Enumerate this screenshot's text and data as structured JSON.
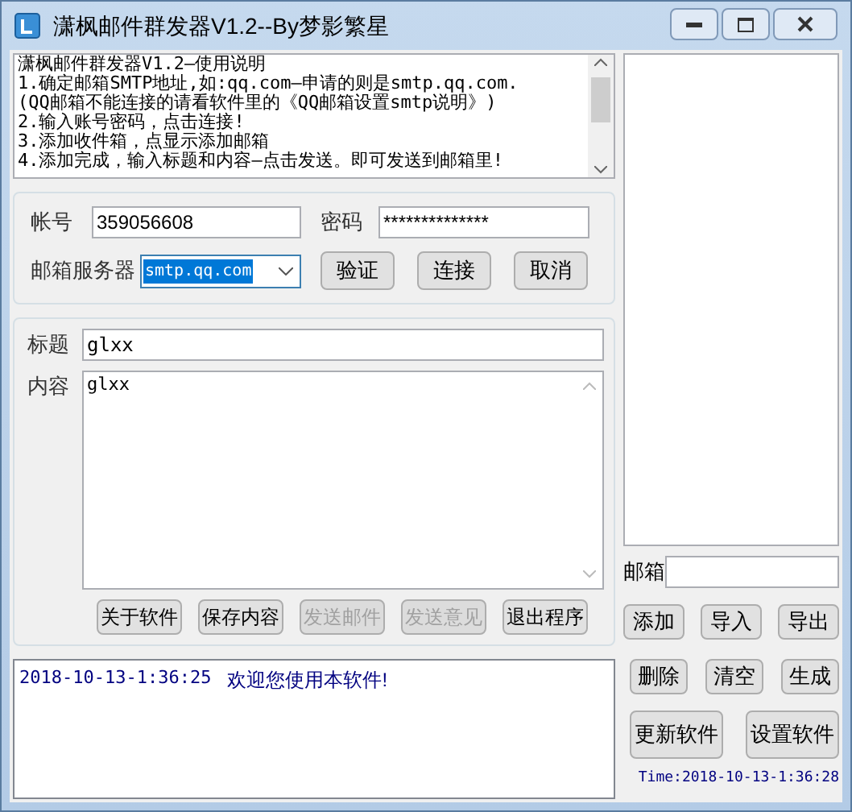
{
  "window": {
    "title": "潇枫邮件群发器V1.2--By梦影繁星"
  },
  "instructions": [
    "潇枫邮件群发器V1.2—使用说明",
    "1.确定邮箱SMTP地址,如:qq.com—申请的则是smtp.qq.com.",
    "(QQ邮箱不能连接的请看软件里的《QQ邮箱设置smtp说明》)",
    "2.输入账号密码，点击连接!",
    "3.添加收件箱，点显示添加邮箱",
    "4.添加完成，输入标题和内容—点击发送。即可发送到邮箱里!"
  ],
  "account": {
    "label": "帐号",
    "value": "359056608"
  },
  "password": {
    "label": "密码",
    "value": "**************"
  },
  "server": {
    "label": "邮箱服务器",
    "value": "smtp.qq.com"
  },
  "login_buttons": [
    {
      "label": "验证",
      "disabled": false
    },
    {
      "label": "连接",
      "disabled": false
    },
    {
      "label": "取消",
      "disabled": false
    }
  ],
  "subject": {
    "label": "标题",
    "value": "glxx"
  },
  "body": {
    "label": "内容",
    "value": "glxx"
  },
  "action_buttons": [
    {
      "label": "关于软件",
      "disabled": false
    },
    {
      "label": "保存内容",
      "disabled": false
    },
    {
      "label": "发送邮件",
      "disabled": true
    },
    {
      "label": "发送意见",
      "disabled": true
    },
    {
      "label": "退出程序",
      "disabled": false
    }
  ],
  "log": [
    {
      "time": "2018-10-13-1:36:25",
      "message": "欢迎您使用本软件!"
    }
  ],
  "email_field": {
    "label": "邮箱"
  },
  "list_buttons": [
    "添加",
    "导入",
    "导出"
  ],
  "edit_buttons": [
    "删除",
    "清空",
    "生成"
  ],
  "tool_buttons": [
    "更新软件",
    "设置软件"
  ],
  "status": "Time:2018-10-13-1:36:28"
}
